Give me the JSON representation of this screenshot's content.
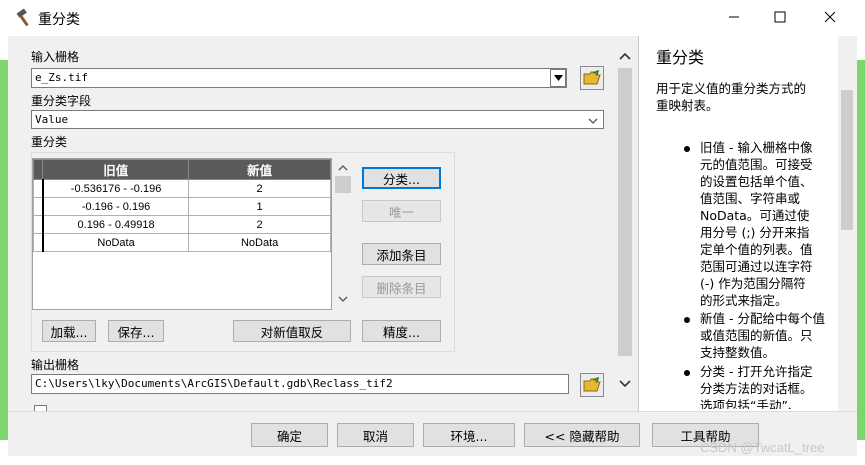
{
  "window": {
    "title": "重分类",
    "controls": {
      "minimize": "—",
      "maximize": "☐",
      "close": "✕"
    }
  },
  "form": {
    "input_raster_label": "输入栅格",
    "input_raster_value": "e_Zs.tif",
    "reclass_field_label": "重分类字段",
    "reclass_field_value": "Value",
    "reclass_label": "重分类",
    "table": {
      "headers": [
        "旧值",
        "新值"
      ],
      "rows": [
        {
          "old": "-0.536176 - -0.196",
          "new": "2"
        },
        {
          "old": "-0.196 - 0.196",
          "new": "1"
        },
        {
          "old": "0.196 - 0.49918",
          "new": "2"
        },
        {
          "old": "NoData",
          "new": "NoData"
        }
      ]
    },
    "side_buttons": {
      "classify": "分类...",
      "unique": "唯一",
      "add_entry": "添加条目",
      "delete_entry": "删除条目"
    },
    "lower_buttons": {
      "load": "加载...",
      "save": "保存...",
      "reverse": "对新值取反",
      "precision": "精度..."
    },
    "output_raster_label": "输出栅格",
    "output_raster_value": "C:\\Users\\lky\\Documents\\ArcGIS\\Default.gdb\\Reclass_tif2"
  },
  "footer": {
    "ok": "确定",
    "cancel": "取消",
    "environments": "环境...",
    "hide_help": "<< 隐藏帮助",
    "tool_help": "工具帮助"
  },
  "help": {
    "title": "重分类",
    "intro": [
      "用于定义值的重分类方式的",
      "重映射表。"
    ],
    "bullets": [
      [
        "旧值 - 输入栅格中像",
        "元的值范围。可接受",
        "的设置包括单个值、",
        "值范围、字符串或",
        "NoData。可通过使",
        "用分号 (;) 分开来指",
        "定单个值的列表。值",
        "范围可通过以连字符",
        "(-) 作为范围分隔符",
        "的形式来指定。"
      ],
      [
        "新值 - 分配给中每个值",
        "或值范围的新值。只",
        "支持整数值。"
      ],
      [
        "分类 - 打开允许指定",
        "分类方法的对话框。",
        "选项包括“手动”、"
      ]
    ]
  },
  "watermark": "CSDN @TwcatL_tree",
  "colors": {
    "accent": "#0078d7",
    "grid_header": "#5a5a5a",
    "dialog_bg": "#f0f0f0"
  }
}
